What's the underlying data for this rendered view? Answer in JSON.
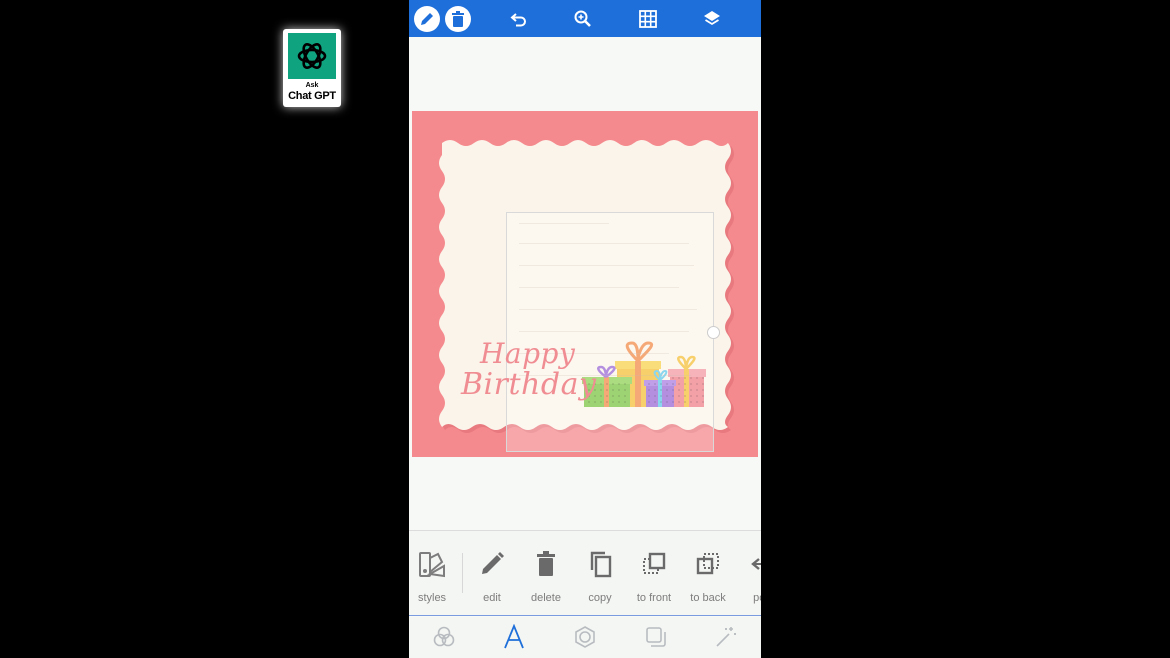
{
  "badge": {
    "ask": "Ask",
    "title": "Chat GPT",
    "logo_icon": "openai-logo-icon",
    "color": "#10a37f"
  },
  "topbar": {
    "color": "#1e6fd9",
    "icons": [
      "pencil-icon",
      "trash-icon",
      "undo-icon",
      "zoom-in-icon",
      "grid-icon",
      "layers-icon"
    ]
  },
  "card": {
    "line1": "Happy",
    "line2": "Birthday",
    "background_color": "#f48a8e",
    "frame_color": "#fbf4ea"
  },
  "toolbar": {
    "tools": [
      {
        "label": "styles",
        "icon": "styles-icon"
      },
      {
        "label": "edit",
        "icon": "pencil-icon"
      },
      {
        "label": "delete",
        "icon": "trash-icon"
      },
      {
        "label": "copy",
        "icon": "copy-icon"
      },
      {
        "label": "to front",
        "icon": "bring-to-front-icon"
      },
      {
        "label": "to back",
        "icon": "send-to-back-icon"
      },
      {
        "label": "pos",
        "icon": "position-icon"
      }
    ]
  },
  "tabs": {
    "icons": [
      "color-circles-icon",
      "text-icon",
      "shape-icon",
      "shadow-icon",
      "magic-wand-icon"
    ],
    "active_index": 1,
    "active_color": "#1e6fd9"
  }
}
